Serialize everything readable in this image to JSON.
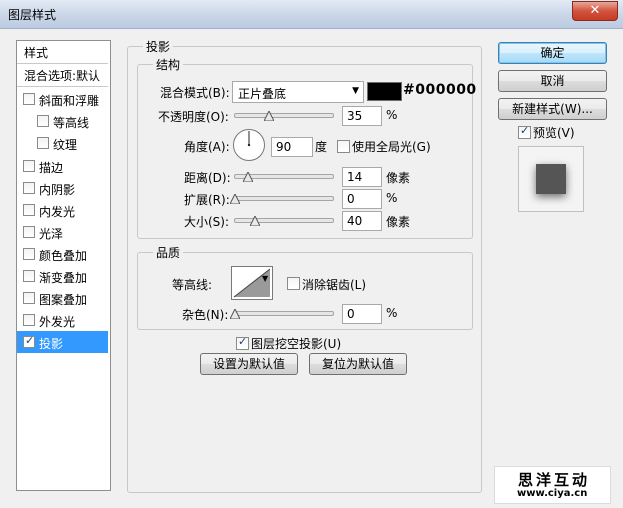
{
  "window": {
    "title": "图层样式",
    "close_glyph": "✕"
  },
  "styles_panel": {
    "header": "样式",
    "blend_options": "混合选项:默认",
    "items": [
      {
        "label": "斜面和浮雕",
        "checked": false,
        "indent": false
      },
      {
        "label": "等高线",
        "checked": false,
        "indent": true
      },
      {
        "label": "纹理",
        "checked": false,
        "indent": true
      },
      {
        "label": "描边",
        "checked": false,
        "indent": false
      },
      {
        "label": "内阴影",
        "checked": false,
        "indent": false
      },
      {
        "label": "内发光",
        "checked": false,
        "indent": false
      },
      {
        "label": "光泽",
        "checked": false,
        "indent": false
      },
      {
        "label": "颜色叠加",
        "checked": false,
        "indent": false
      },
      {
        "label": "渐变叠加",
        "checked": false,
        "indent": false
      },
      {
        "label": "图案叠加",
        "checked": false,
        "indent": false
      },
      {
        "label": "外发光",
        "checked": false,
        "indent": false
      },
      {
        "label": "投影",
        "checked": true,
        "indent": false,
        "selected": true
      }
    ]
  },
  "drop_shadow": {
    "title": "投影",
    "structure": {
      "title": "结构",
      "blend_mode_label": "混合模式(B):",
      "blend_mode_value": "正片叠底",
      "color_hex": "#000000",
      "opacity_label": "不透明度(O):",
      "opacity_value": "35",
      "opacity_unit": "%",
      "angle_label": "角度(A):",
      "angle_value": "90",
      "angle_unit": "度",
      "global_light_label": "使用全局光(G)",
      "global_light_checked": false,
      "distance_label": "距离(D):",
      "distance_value": "14",
      "distance_unit": "像素",
      "spread_label": "扩展(R):",
      "spread_value": "0",
      "spread_unit": "%",
      "size_label": "大小(S):",
      "size_value": "40",
      "size_unit": "像素"
    },
    "quality": {
      "title": "品质",
      "contour_label": "等高线:",
      "anti_alias_label": "消除锯齿(L)",
      "anti_alias_checked": false,
      "noise_label": "杂色(N):",
      "noise_value": "0",
      "noise_unit": "%"
    },
    "knockout_label": "图层挖空投影(U)",
    "knockout_checked": true,
    "make_default": "设置为默认值",
    "reset_default": "复位为默认值"
  },
  "buttons": {
    "ok": "确定",
    "cancel": "取消",
    "new_style": "新建样式(W)...",
    "preview_label": "预览(V)",
    "preview_checked": true
  },
  "watermark": {
    "name": "思洋互动",
    "url": "www.ciya.cn"
  },
  "colors": {
    "selected_row": "#3399ff",
    "title_gradient_start": "#e3eaf4",
    "close_button": "#c73b22",
    "shadow_color": "#000000"
  }
}
